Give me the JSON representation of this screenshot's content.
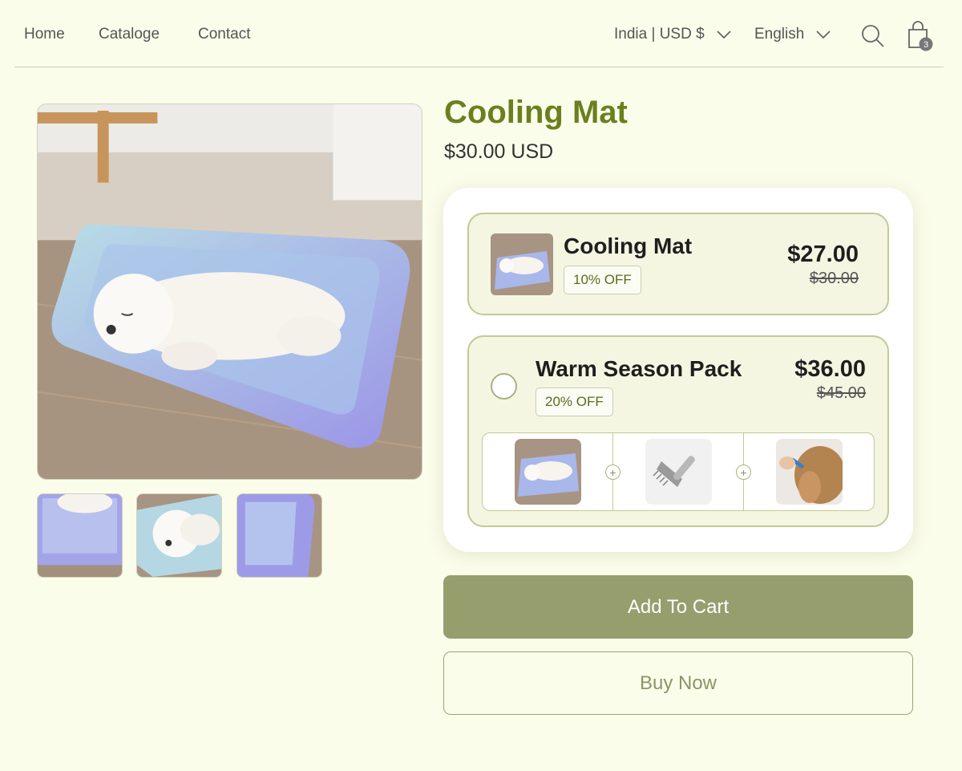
{
  "nav": {
    "links": [
      "Home",
      "Cataloge",
      "Contact"
    ],
    "country_currency": "India | USD $",
    "language": "English",
    "cart_count": "3"
  },
  "product": {
    "title": "Cooling Mat",
    "price": "$30.00 USD"
  },
  "offers": [
    {
      "name": "Cooling Mat",
      "badge": "10% OFF",
      "sale_price": "$27.00",
      "original_price": "$30.00",
      "selected": true
    },
    {
      "name": "Warm Season Pack",
      "badge": "20% OFF",
      "sale_price": "$36.00",
      "original_price": "$45.00",
      "selected": false,
      "items": [
        "cooling mat",
        "grooming comb",
        "flea drops"
      ]
    }
  ],
  "buttons": {
    "add_to_cart": "Add To Cart",
    "buy_now": "Buy Now"
  },
  "colors": {
    "background": "#fbfdeb",
    "title_green": "#6b7f1f",
    "button_olive": "#969e6e",
    "offer_fill": "#f4f6e2",
    "offer_border": "#c2c994"
  },
  "icons": [
    "chevron-down-icon",
    "search-icon",
    "shopping-bag-icon",
    "plus-icon"
  ]
}
